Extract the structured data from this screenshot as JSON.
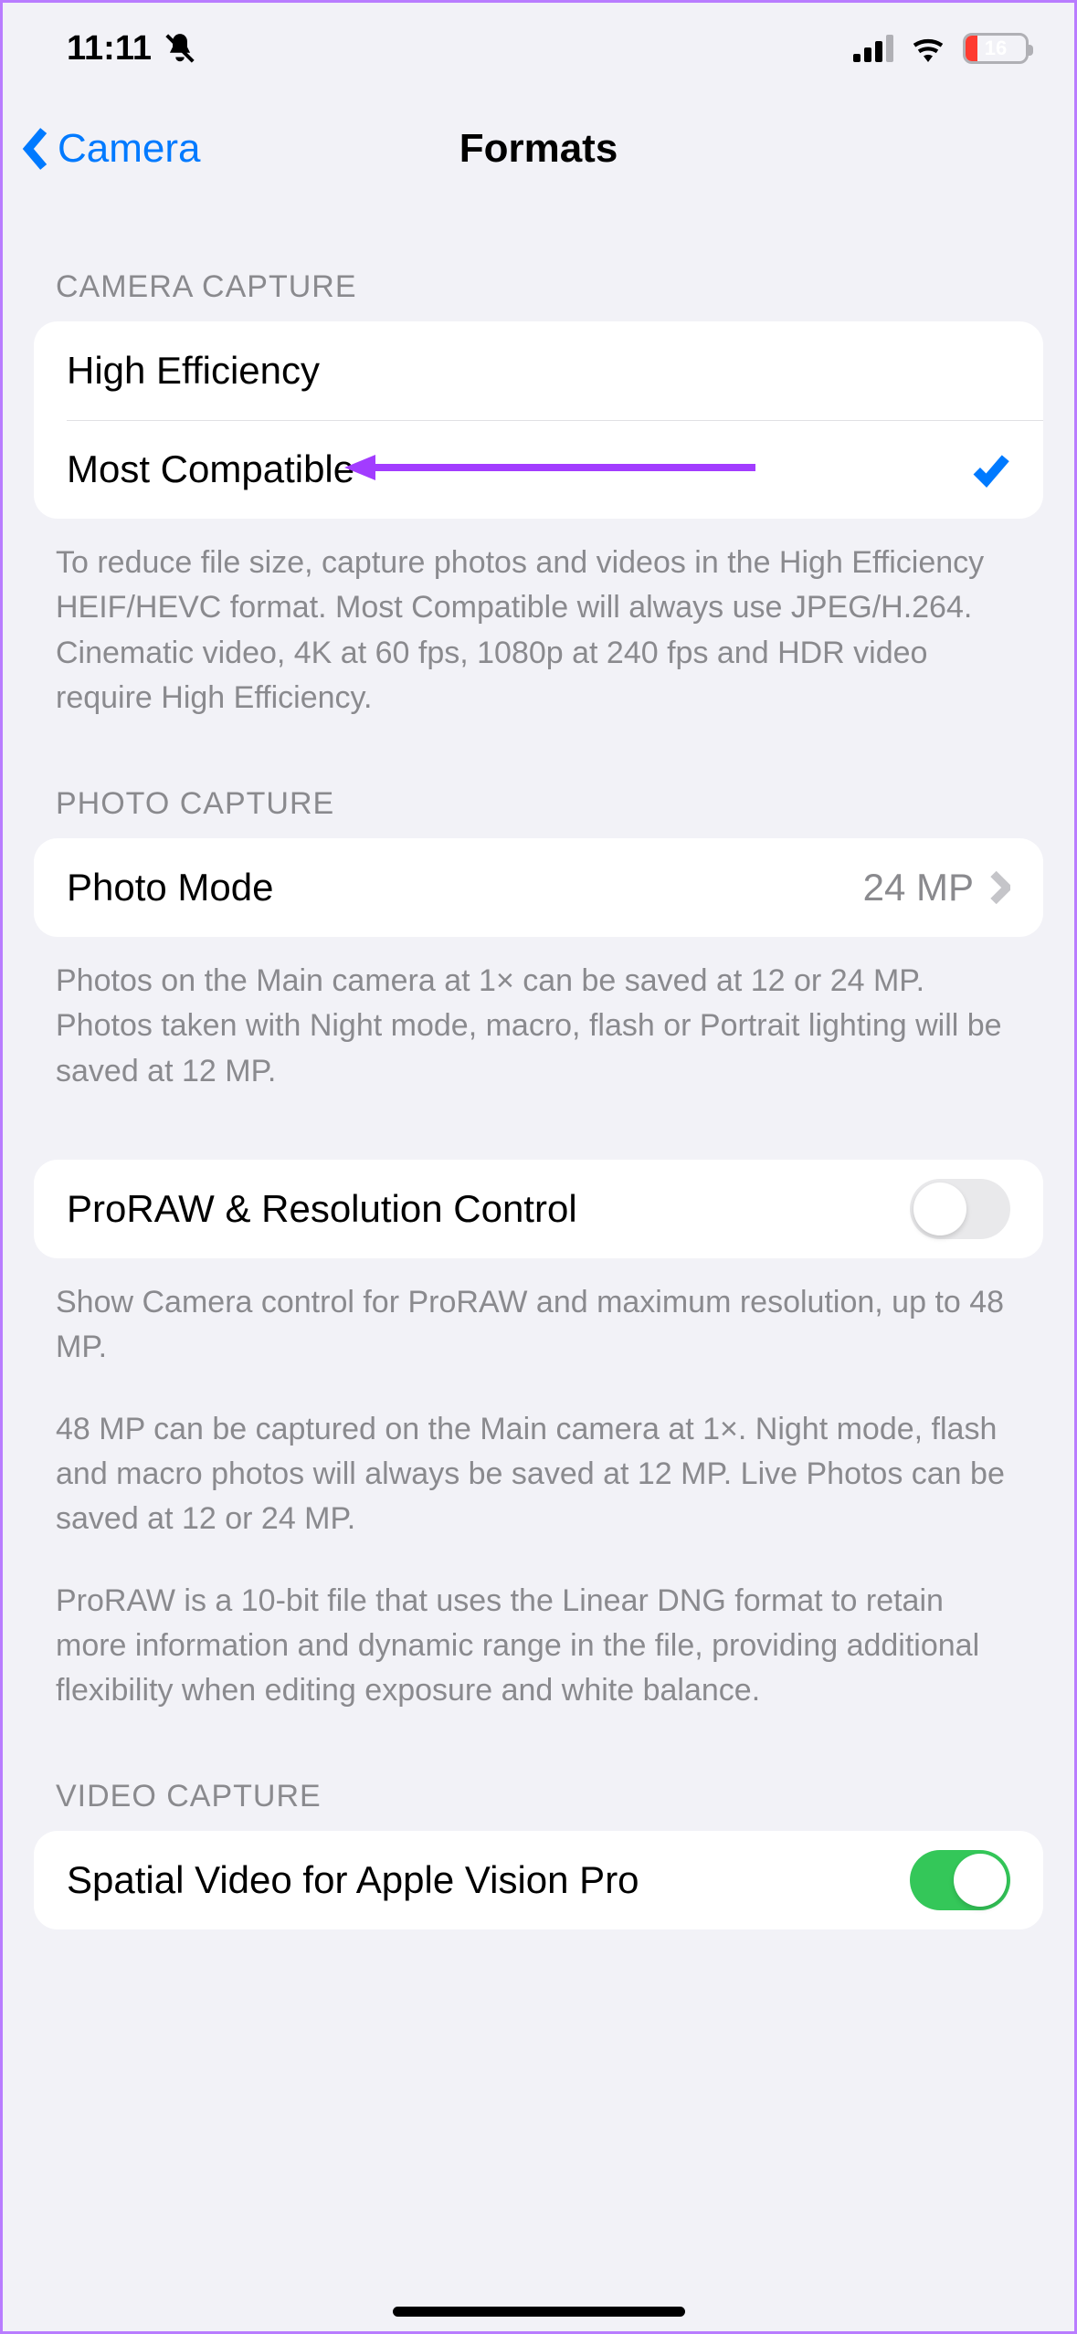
{
  "status": {
    "time": "11:11",
    "battery_pct": "16"
  },
  "nav": {
    "back_label": "Camera",
    "title": "Formats"
  },
  "sections": {
    "camera_capture": {
      "header": "CAMERA CAPTURE",
      "rows": {
        "high_eff": "High Efficiency",
        "most_compat": "Most Compatible"
      },
      "footer": "To reduce file size, capture photos and videos in the High Efficiency HEIF/HEVC format. Most Compatible will always use JPEG/H.264. Cinematic video, 4K at 60 fps, 1080p at 240 fps and HDR video require High Efficiency."
    },
    "photo_capture": {
      "header": "PHOTO CAPTURE",
      "photo_mode_label": "Photo Mode",
      "photo_mode_value": "24 MP",
      "footer": "Photos on the Main camera at 1× can be saved at 12 or 24 MP. Photos taken with Night mode, macro, flash or Portrait lighting will be saved at 12 MP."
    },
    "proraw": {
      "label": "ProRAW & Resolution Control",
      "footer1": "Show Camera control for ProRAW and maximum resolution, up to 48 MP.",
      "footer2": "48 MP can be captured on the Main camera at 1×. Night mode, flash and macro photos will always be saved at 12 MP. Live Photos can be saved at 12 or 24 MP.",
      "footer3": "ProRAW is a 10-bit file that uses the Linear DNG format to retain more information and dynamic range in the file, providing additional flexibility when editing exposure and white balance."
    },
    "video_capture": {
      "header": "VIDEO CAPTURE",
      "spatial_label": "Spatial Video for Apple Vision Pro"
    }
  }
}
